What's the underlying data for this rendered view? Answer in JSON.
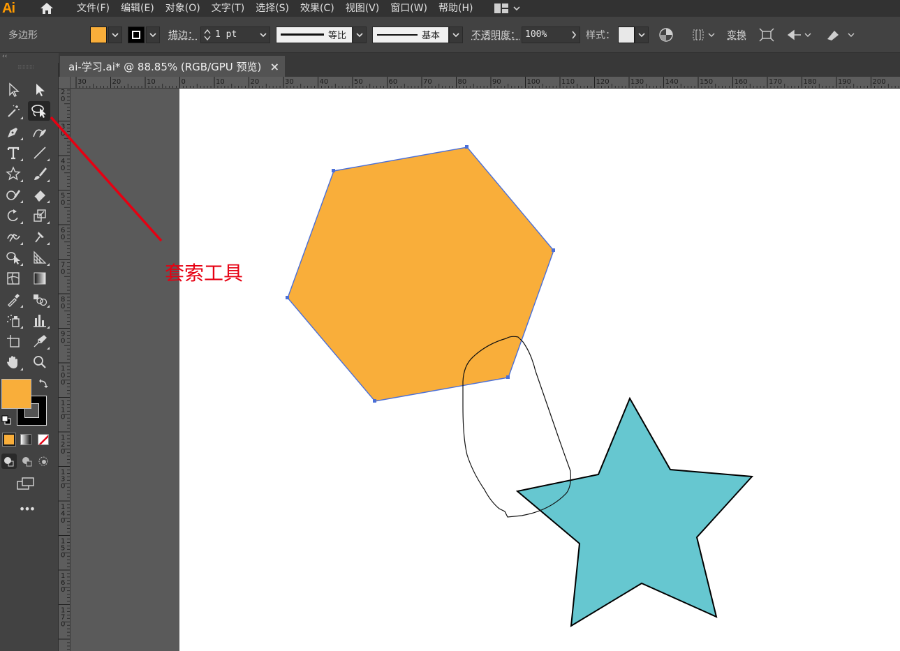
{
  "app": {
    "logo": "Ai"
  },
  "menu": [
    "文件(F)",
    "编辑(E)",
    "对象(O)",
    "文字(T)",
    "选择(S)",
    "效果(C)",
    "视图(V)",
    "窗口(W)",
    "帮助(H)"
  ],
  "control_bar": {
    "tool_name": "多边形",
    "fill_color": "#F9AE3A",
    "stroke_label": "描边：",
    "stroke_weight": "1 pt",
    "stroke_profile_label": "等比",
    "brush_label": "基本",
    "opacity_label": "不透明度：",
    "opacity_value": "100%",
    "style_label": "样式：",
    "transform_label": "变换"
  },
  "panel_strip": {
    "collapse_glyph": "‹‹"
  },
  "document_tab": {
    "title": "ai-学习.ai* @ 88.85% (RGB/GPU 预览)",
    "close_glyph": "×"
  },
  "tools": {
    "fill_color": "#F9AE3A",
    "stroke_color": "#000000",
    "more_glyph": "•••"
  },
  "ruler_top": {
    "labels": [
      "30",
      "20",
      "10",
      "0",
      "10",
      "20",
      "30",
      "40",
      "50",
      "60",
      "70",
      "80",
      "90",
      "100",
      "110",
      "120",
      "130",
      "140",
      "150",
      "160",
      "170",
      "180",
      "190",
      "200"
    ]
  },
  "ruler_left": {
    "labels": [
      "2",
      "0",
      "3",
      "0",
      "4",
      "0",
      "5",
      "0",
      "6",
      "0",
      "7",
      "0",
      "8",
      "0",
      "9",
      "0",
      "1",
      "0",
      "0",
      "1",
      "1",
      "0",
      "1",
      "2",
      "0",
      "1",
      "3",
      "0",
      "1",
      "4",
      "0",
      "1",
      "5",
      "0",
      "1",
      "6",
      "0",
      "1",
      "7",
      "0",
      "1",
      "8",
      "0"
    ]
  },
  "annotation": {
    "text": "套索工具",
    "color": "#E60012"
  },
  "shapes": {
    "hexagon_fill": "#F9AE3A",
    "hexagon_selection_color": "#4A6FD8",
    "star_fill": "#66C7D0",
    "star_stroke": "#000000"
  }
}
